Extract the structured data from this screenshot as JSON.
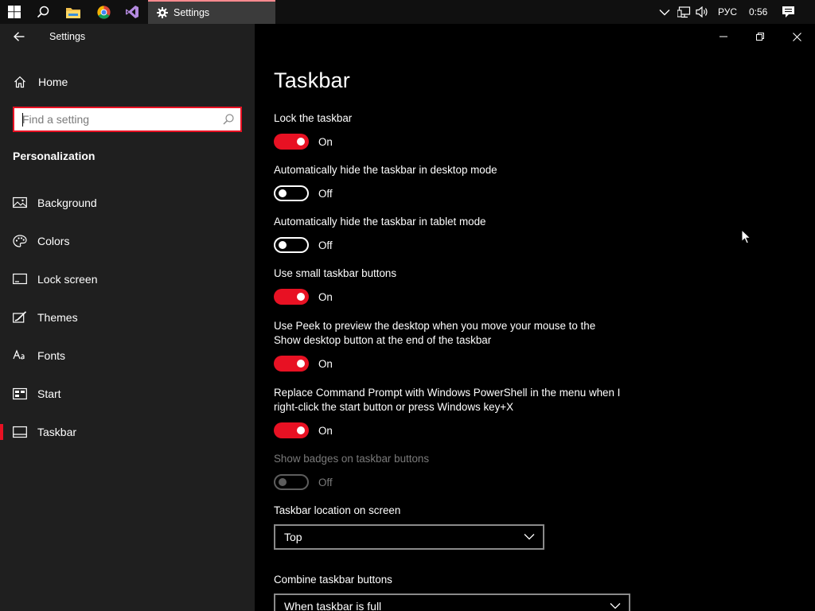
{
  "taskbar": {
    "settings_task_label": "Settings",
    "tray": {
      "language": "РУС",
      "time": "0:56"
    }
  },
  "window": {
    "title": "Settings"
  },
  "sidebar": {
    "home_label": "Home",
    "search_placeholder": "Find a setting",
    "section_title": "Personalization",
    "items": [
      {
        "label": "Background",
        "icon": "background-icon"
      },
      {
        "label": "Colors",
        "icon": "colors-icon"
      },
      {
        "label": "Lock screen",
        "icon": "lock-screen-icon"
      },
      {
        "label": "Themes",
        "icon": "themes-icon"
      },
      {
        "label": "Fonts",
        "icon": "fonts-icon"
      },
      {
        "label": "Start",
        "icon": "start-icon"
      },
      {
        "label": "Taskbar",
        "icon": "taskbar-icon",
        "selected": true
      }
    ]
  },
  "main": {
    "title": "Taskbar",
    "settings": [
      {
        "label": "Lock the taskbar",
        "state": "On"
      },
      {
        "label": "Automatically hide the taskbar in desktop mode",
        "state": "Off"
      },
      {
        "label": "Automatically hide the taskbar in tablet mode",
        "state": "Off"
      },
      {
        "label": "Use small taskbar buttons",
        "state": "On"
      },
      {
        "label": "Use Peek to preview the desktop when you move your mouse to the Show desktop button at the end of the taskbar",
        "state": "On"
      },
      {
        "label": "Replace Command Prompt with Windows PowerShell in the menu when I right-click the start button or press Windows key+X",
        "state": "On"
      },
      {
        "label": "Show badges on taskbar buttons",
        "state": "Off",
        "disabled": true
      }
    ],
    "location": {
      "label": "Taskbar location on screen",
      "value": "Top"
    },
    "combine": {
      "label": "Combine taskbar buttons",
      "value": "When taskbar is full"
    }
  },
  "colors": {
    "accent": "#e81123",
    "sidebar_bg": "#1f1f1f",
    "content_bg": "#000000"
  }
}
